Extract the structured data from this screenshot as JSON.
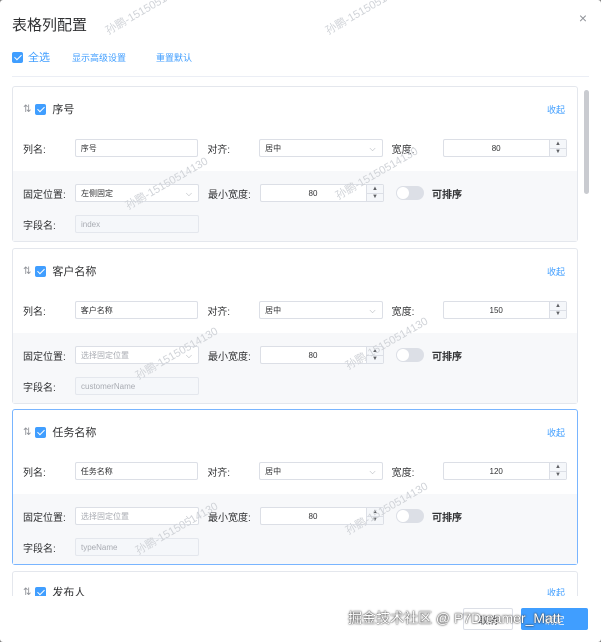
{
  "dialog": {
    "title": "表格列配置",
    "close_glyph": "×"
  },
  "toolbar": {
    "select_all": "全选",
    "show_advanced": "显示高级设置",
    "reset_default": "重置默认"
  },
  "labels": {
    "col_name": "列名:",
    "align": "对齐:",
    "width": "宽度:",
    "fixed": "固定位置:",
    "min_width": "最小宽度:",
    "sortable": "可排序",
    "field": "字段名:",
    "collapse": "收起",
    "fixed_placeholder": "选择固定位置"
  },
  "columns": [
    {
      "title": "序号",
      "name": "序号",
      "align": "居中",
      "width": "80",
      "fixed": "左侧固定",
      "min_width": "80",
      "field": "index",
      "checked": true,
      "sortable": false
    },
    {
      "title": "客户名称",
      "name": "客户名称",
      "align": "居中",
      "width": "150",
      "fixed": "",
      "min_width": "80",
      "field": "customerName",
      "checked": true,
      "sortable": false
    },
    {
      "title": "任务名称",
      "name": "任务名称",
      "align": "居中",
      "width": "120",
      "fixed": "",
      "min_width": "80",
      "field": "typeName",
      "checked": true,
      "sortable": false
    },
    {
      "title": "发布人",
      "checked": true
    }
  ],
  "footer": {
    "cancel": "取消",
    "confirm": "确定"
  },
  "watermark": "孙鹏-15150514130",
  "overlay_text": "掘金技术社区 @ P7Dreamer_Matt",
  "colors": {
    "accent": "#409eff"
  }
}
